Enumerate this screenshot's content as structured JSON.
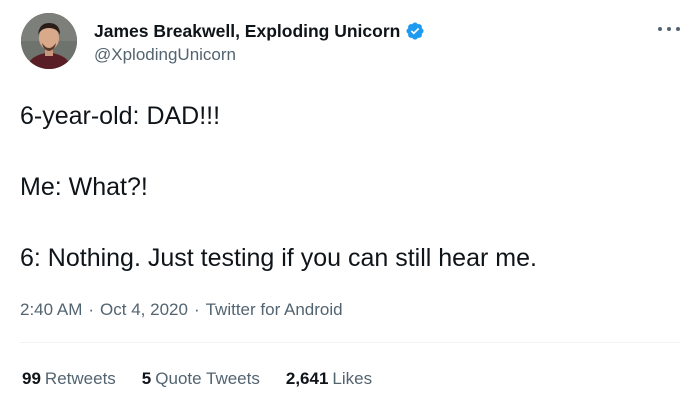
{
  "author": {
    "display_name": "James Breakwell, Exploding Unicorn",
    "handle": "@XplodingUnicorn",
    "verified": true,
    "avatar_icon": "profile-photo"
  },
  "tweet": {
    "lines": [
      "6-year-old: DAD!!!",
      "Me: What?!",
      "6: Nothing. Just testing if you can still hear me."
    ]
  },
  "meta": {
    "time": "2:40 AM",
    "separator": "·",
    "date": "Oct 4, 2020",
    "source": "Twitter for Android"
  },
  "stats": {
    "retweets_count": "99",
    "retweets_label": "Retweets",
    "quotes_count": "5",
    "quotes_label": "Quote Tweets",
    "likes_count": "2,641",
    "likes_label": "Likes"
  },
  "colors": {
    "text_primary": "#0f1419",
    "text_secondary": "#536471",
    "verified_blue": "#1d9bf0",
    "divider": "#eff3f4"
  },
  "icons": {
    "verified": "verified-badge-icon",
    "more": "more-options-icon"
  }
}
